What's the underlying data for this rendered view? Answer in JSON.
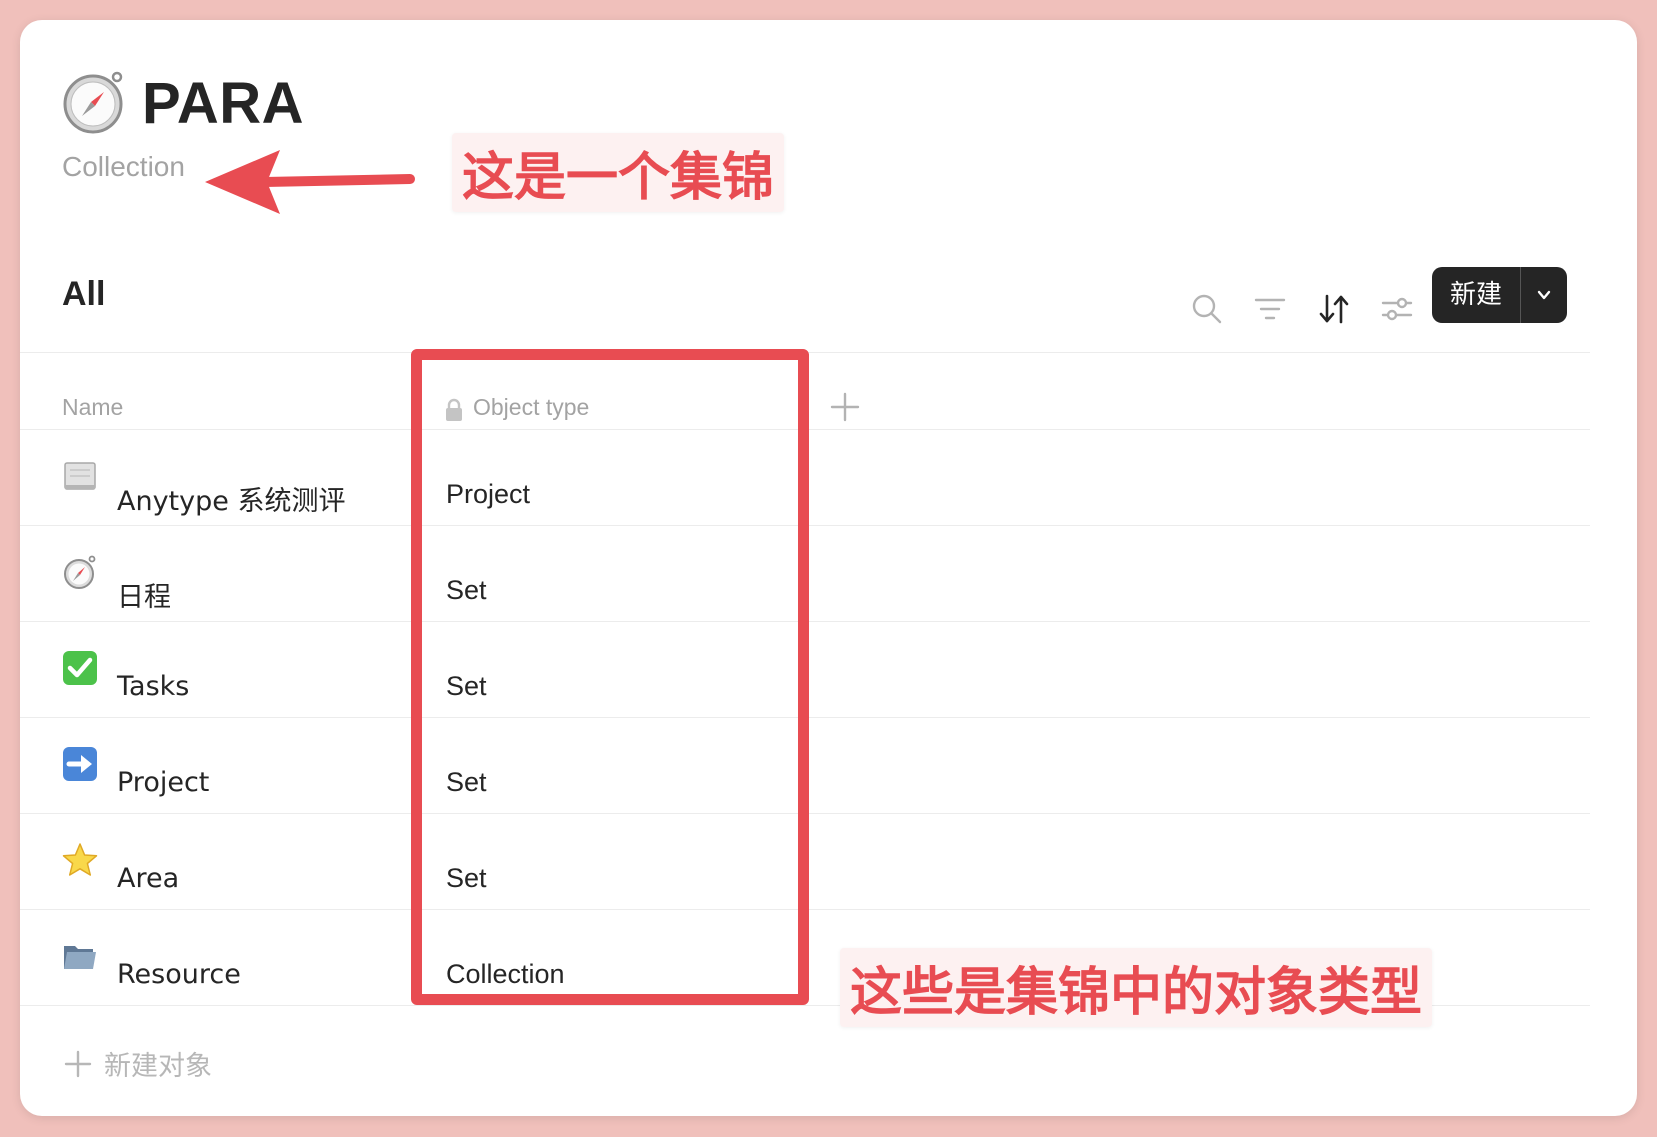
{
  "page": {
    "title": "PARA",
    "subtitle": "Collection"
  },
  "annotations": {
    "top": "这是一个集锦",
    "bottom": "这些是集锦中的对象类型"
  },
  "view": {
    "label": "All",
    "toolbar": {
      "icons": [
        "search-icon",
        "filter-icon",
        "sort-icon",
        "settings-sliders-icon"
      ],
      "new_button_label": "新建",
      "new_button_menu_icon": "chevron-down-icon"
    }
  },
  "table": {
    "columns": [
      {
        "label": "Name"
      },
      {
        "label": "Object type",
        "icon": "lock-icon"
      }
    ],
    "rows": [
      {
        "icon": "document-icon",
        "name": "Anytype 系统测评",
        "type": "Project"
      },
      {
        "icon": "compass-icon",
        "name": "日程",
        "type": "Set"
      },
      {
        "icon": "checkmark-icon",
        "name": "Tasks",
        "type": "Set"
      },
      {
        "icon": "arrow-right-icon",
        "name": "Project",
        "type": "Set"
      },
      {
        "icon": "star-icon",
        "name": "Area",
        "type": "Set"
      },
      {
        "icon": "folder-icon",
        "name": "Resource",
        "type": "Collection"
      }
    ],
    "new_object_label": "新建对象"
  },
  "colors": {
    "accent_annotation": "#e84c52",
    "button_dark": "#252525"
  }
}
